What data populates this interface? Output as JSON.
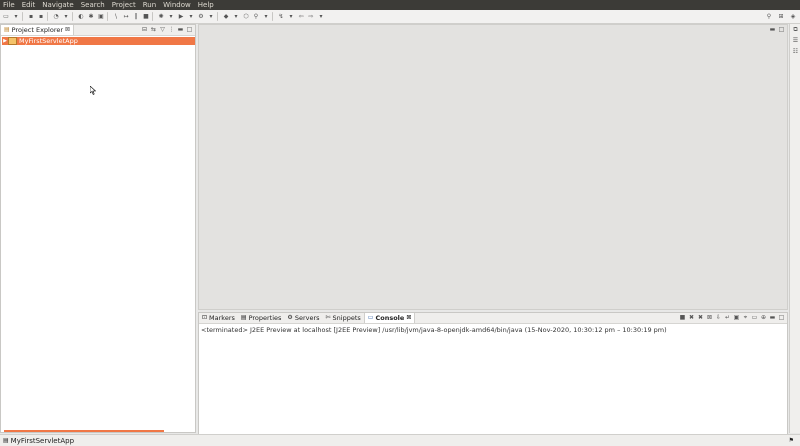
{
  "menu": [
    "File",
    "Edit",
    "Navigate",
    "Search",
    "Project",
    "Run",
    "Window",
    "Help"
  ],
  "explorer": {
    "tab_label": "Project Explorer",
    "close_glyph": "⊠",
    "tree": [
      {
        "label": "MyFirstServletApp",
        "expanded": false,
        "selected": true
      }
    ]
  },
  "console_tabs": [
    {
      "label": "Markers",
      "icon": "markers-icon"
    },
    {
      "label": "Properties",
      "icon": "properties-icon"
    },
    {
      "label": "Servers",
      "icon": "servers-icon"
    },
    {
      "label": "Snippets",
      "icon": "snippets-icon"
    },
    {
      "label": "Console",
      "icon": "console-icon",
      "active": true
    }
  ],
  "console": {
    "close_glyph": "⊠",
    "status_line": "<terminated> J2EE Preview at localhost [J2EE Preview] /usr/lib/jvm/java-8-openjdk-amd64/bin/java  (15-Nov-2020, 10:30:12 pm – 10:30:19 pm)"
  },
  "statusbar": {
    "selected_item": "MyFirstServletApp"
  },
  "colors": {
    "selection": "#f07746",
    "menubar": "#3c3b37"
  }
}
